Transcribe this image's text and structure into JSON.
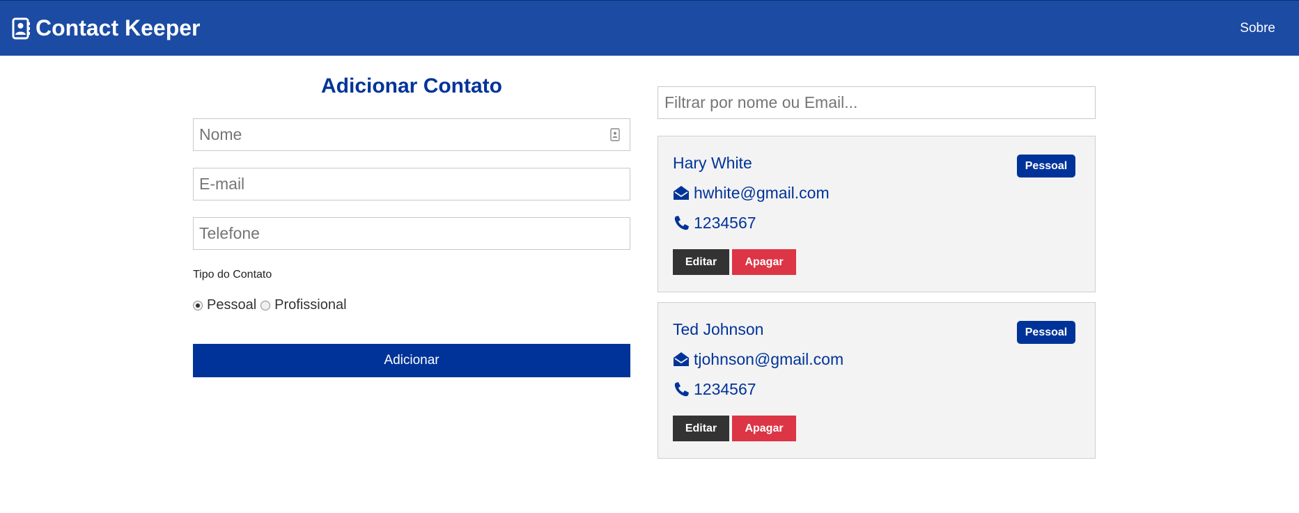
{
  "navbar": {
    "brand": "Contact Keeper",
    "about_link": "Sobre"
  },
  "form": {
    "title": "Adicionar Contato",
    "name_placeholder": "Nome",
    "email_placeholder": "E-mail",
    "phone_placeholder": "Telefone",
    "type_label": "Tipo do Contato",
    "type_options": [
      "Pessoal",
      "Profissional"
    ],
    "selected_type": "Pessoal",
    "submit_label": "Adicionar"
  },
  "filter": {
    "placeholder": "Filtrar por nome ou Email..."
  },
  "contacts": [
    {
      "name": "Hary White",
      "email": "hwhite@gmail.com",
      "phone": "1234567",
      "type": "Pessoal",
      "edit_label": "Editar",
      "delete_label": "Apagar"
    },
    {
      "name": "Ted Johnson",
      "email": "tjohnson@gmail.com",
      "phone": "1234567",
      "type": "Pessoal",
      "edit_label": "Editar",
      "delete_label": "Apagar"
    }
  ],
  "colors": {
    "navbar": "#1b4ba3",
    "primary": "#003399",
    "dark": "#333333",
    "danger": "#dc3545",
    "card_bg": "#f3f3f3"
  },
  "icons": {
    "brand": "address-book-icon",
    "email": "envelope-open-icon",
    "phone": "phone-icon"
  }
}
